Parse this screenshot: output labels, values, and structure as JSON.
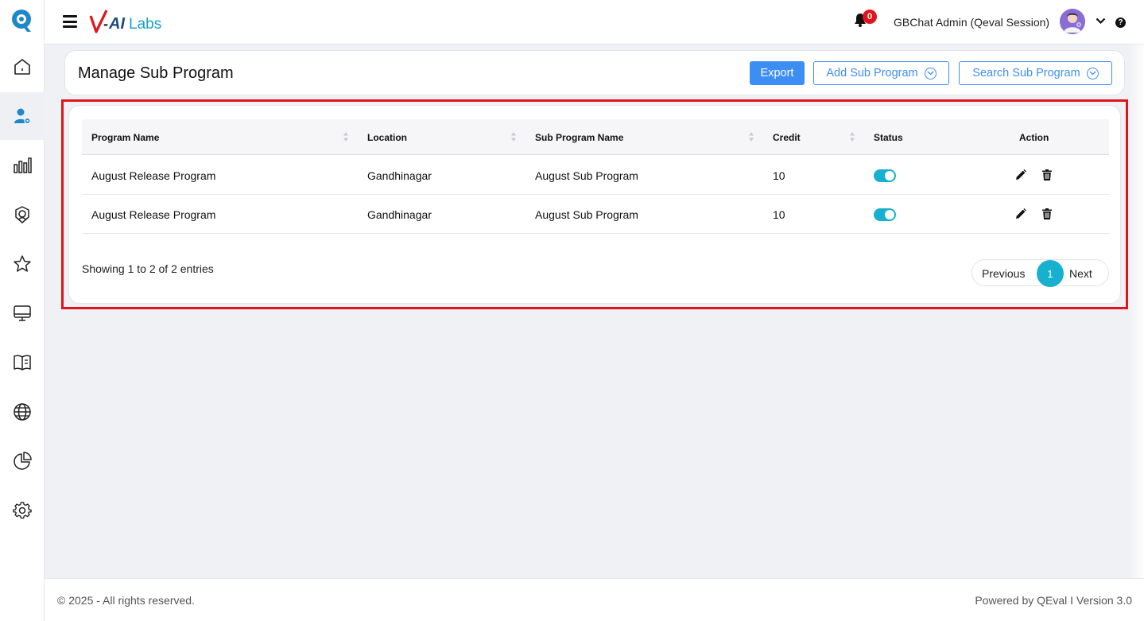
{
  "sidebar": {
    "items": [
      {
        "name": "home-icon"
      },
      {
        "name": "user-settings-icon",
        "active": true
      },
      {
        "name": "bar-chart-icon"
      },
      {
        "name": "face-scan-icon"
      },
      {
        "name": "star-icon"
      },
      {
        "name": "monitor-icon"
      },
      {
        "name": "book-icon"
      },
      {
        "name": "globe-icon"
      },
      {
        "name": "pie-chart-icon"
      },
      {
        "name": "gear-icon"
      }
    ]
  },
  "header": {
    "brand_prefix": "-",
    "brand_ai": "AI",
    "brand_labs": "Labs",
    "notification_count": "0",
    "user_name": "GBChat Admin (Qeval Session)",
    "help_glyph": "?"
  },
  "page": {
    "title": "Manage Sub Program",
    "export_label": "Export",
    "add_label": "Add Sub Program",
    "search_label": "Search Sub Program"
  },
  "table": {
    "columns": [
      "Program Name",
      "Location",
      "Sub Program Name",
      "Credit",
      "Status",
      "Action"
    ],
    "rows": [
      {
        "program": "August Release Program",
        "location": "Gandhinagar",
        "sub_program": "August Sub Program",
        "credit": "10",
        "status": true
      },
      {
        "program": "August Release Program",
        "location": "Gandhinagar",
        "sub_program": "August Sub Program",
        "credit": "10",
        "status": true
      }
    ],
    "entries_text": "Showing 1 to 2 of 2 entries",
    "pager": {
      "previous": "Previous",
      "current": "1",
      "next": "Next"
    }
  },
  "footer": {
    "left": "© 2025 - All rights reserved.",
    "right": "Powered by QEval I Version 3.0"
  },
  "colors": {
    "accent": "#3d8ef4",
    "toggle": "#17b0cf",
    "highlight": "#e3131c"
  }
}
